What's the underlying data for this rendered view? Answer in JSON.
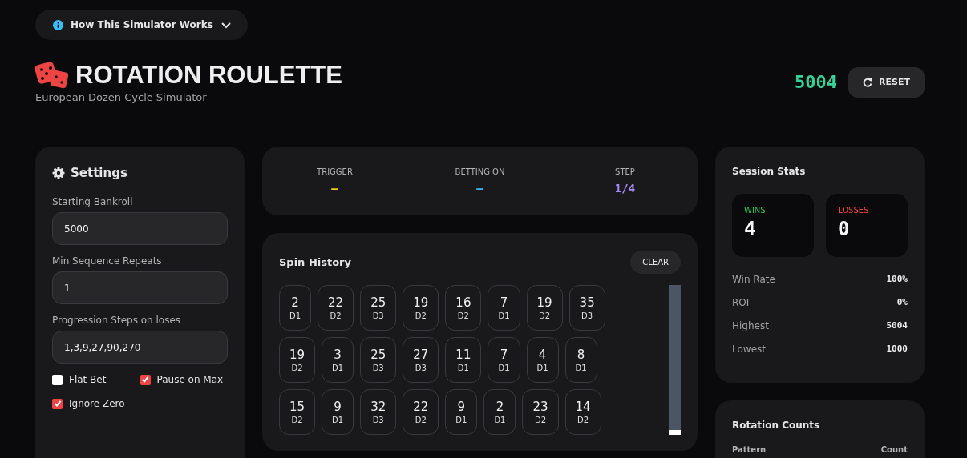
{
  "info_toggle": {
    "label": "How This Simulator Works",
    "expanded": false
  },
  "header": {
    "title": "ROTATION ROULETTE",
    "subtitle": "European Dozen Cycle Simulator",
    "bankroll": "5004",
    "reset_label": "RESET"
  },
  "settings": {
    "title": "Settings",
    "fields": [
      {
        "label": "Starting Bankroll",
        "value": "5000"
      },
      {
        "label": "Min Sequence Repeats",
        "value": "1"
      },
      {
        "label": "Progression Steps on loses",
        "value": "1,3,9,27,90,270"
      }
    ],
    "checkboxes": [
      {
        "label": "Flat Bet",
        "checked": false
      },
      {
        "label": "Pause on Max",
        "checked": true
      },
      {
        "label": "Ignore Zero",
        "checked": true
      }
    ]
  },
  "status": [
    {
      "label": "TRIGGER",
      "value": "–",
      "color": "#facc15"
    },
    {
      "label": "BETTING ON",
      "value": "–",
      "color": "#38bdf8"
    },
    {
      "label": "STEP",
      "value": "1/4",
      "color": "#a78bfa"
    }
  ],
  "spin_history": {
    "title": "Spin History",
    "clear_label": "CLEAR",
    "rows": [
      [
        {
          "number": "2",
          "dozen": "D1"
        },
        {
          "number": "22",
          "dozen": "D2"
        },
        {
          "number": "25",
          "dozen": "D3"
        },
        {
          "number": "19",
          "dozen": "D2"
        },
        {
          "number": "16",
          "dozen": "D2"
        },
        {
          "number": "7",
          "dozen": "D1"
        },
        {
          "number": "19",
          "dozen": "D2"
        },
        {
          "number": "35",
          "dozen": "D3"
        }
      ],
      [
        {
          "number": "19",
          "dozen": "D2"
        },
        {
          "number": "3",
          "dozen": "D1"
        },
        {
          "number": "25",
          "dozen": "D3"
        },
        {
          "number": "27",
          "dozen": "D3"
        },
        {
          "number": "11",
          "dozen": "D1"
        },
        {
          "number": "7",
          "dozen": "D1"
        },
        {
          "number": "4",
          "dozen": "D1"
        },
        {
          "number": "8",
          "dozen": "D1"
        }
      ],
      [
        {
          "number": "15",
          "dozen": "D2"
        },
        {
          "number": "9",
          "dozen": "D1"
        },
        {
          "number": "32",
          "dozen": "D3"
        },
        {
          "number": "22",
          "dozen": "D2"
        },
        {
          "number": "9",
          "dozen": "D1"
        },
        {
          "number": "2",
          "dozen": "D1"
        },
        {
          "number": "23",
          "dozen": "D2"
        },
        {
          "number": "14",
          "dozen": "D2"
        }
      ]
    ]
  },
  "session_stats": {
    "title": "Session Stats",
    "tiles": [
      {
        "label": "WINS",
        "value": "4",
        "color": "#22c55e"
      },
      {
        "label": "LOSSES",
        "value": "0",
        "color": "#ef4444"
      }
    ],
    "rows": [
      {
        "label": "Win Rate",
        "value": "100%"
      },
      {
        "label": "ROI",
        "value": "0%"
      },
      {
        "label": "Highest",
        "value": "5004"
      },
      {
        "label": "Lowest",
        "value": "1000"
      }
    ]
  },
  "rotation_counts": {
    "title": "Rotation Counts",
    "columns": [
      "Pattern",
      "Count"
    ]
  }
}
